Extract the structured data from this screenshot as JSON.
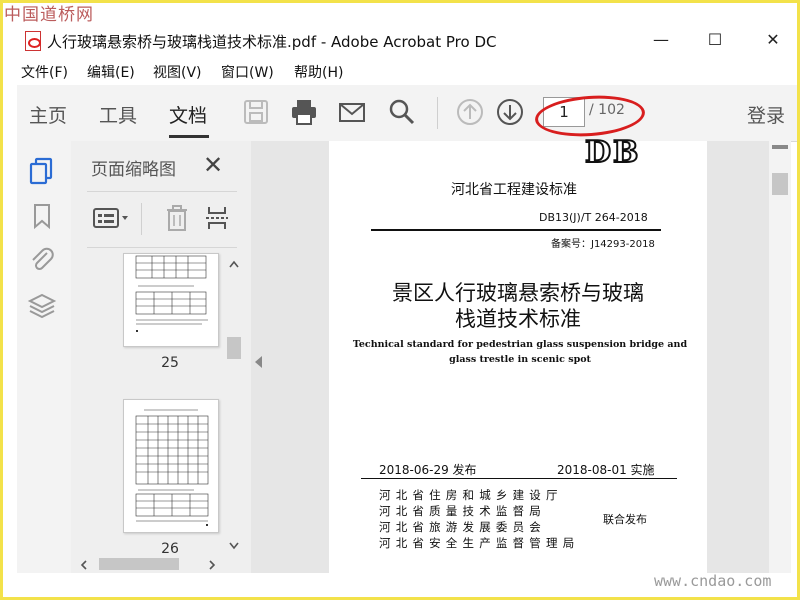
{
  "watermark_top": "中国道桥网",
  "watermark_bottom": "www.cndao.com",
  "window": {
    "title": "人行玻璃悬索桥与玻璃栈道技术标准.pdf - Adobe Acrobat Pro DC",
    "minimize": "—",
    "maximize": "☐",
    "close": "✕"
  },
  "menu": [
    "文件(F)",
    "编辑(E)",
    "视图(V)",
    "窗口(W)",
    "帮助(H)"
  ],
  "toolbar": {
    "tabs": [
      "主页",
      "工具",
      "文档"
    ],
    "active_tab": "文档",
    "page_current": "1",
    "page_total": "/ 102",
    "login": "登录",
    "icons": [
      "save-icon",
      "print-icon",
      "email-icon",
      "search-icon",
      "page-up-icon",
      "page-down-icon"
    ]
  },
  "thumb_panel": {
    "title": "页面缩略图",
    "close": "✕",
    "pages": [
      "25",
      "26"
    ]
  },
  "document": {
    "logo": "DB",
    "standard_type": "河北省工程建设标准",
    "code": "DB13(J)/T 264-2018",
    "record": "备案号：J14293-2018",
    "title_line1": "景区人行玻璃悬索桥与玻璃",
    "title_line2": "栈道技术标准",
    "english_line1": "Technical standard for pedestrian glass suspension bridge and",
    "english_line2": "glass trestle in scenic spot",
    "publish_date": "2018-06-29 发布",
    "implement_date": "2018-08-01 实施",
    "issuers": [
      "河北省住房和城乡建设厅",
      "河北省质量技术监督局",
      "河北省旅游发展委员会",
      "河北省安全生产监督管理局"
    ],
    "joint": "联合发布"
  },
  "colors": {
    "frame": "#f3e24a",
    "annotation": "#d81e1e",
    "toolbar_bg": "#f3f3f3",
    "accent_blue": "#2b6cd4"
  }
}
